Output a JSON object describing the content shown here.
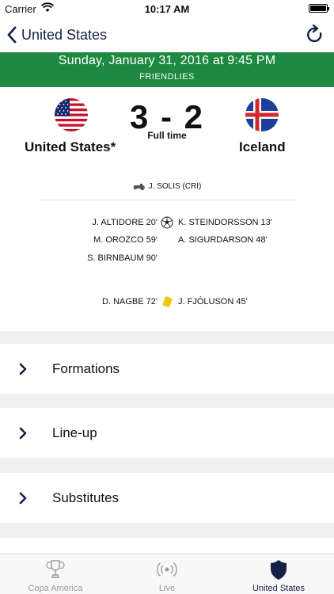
{
  "status_bar": {
    "carrier": "Carrier",
    "time": "10:17 AM"
  },
  "nav": {
    "back_label": "United States"
  },
  "match": {
    "date": "Sunday, January 31, 2016 at 9:45 PM",
    "competition": "FRIENDLIES",
    "home_team": "United States*",
    "away_team": "Iceland",
    "score": "3 - 2",
    "status": "Full time",
    "referee": "J. SOLIS (CRI)"
  },
  "goals": {
    "home": [
      "J. ALTIDORE 20'",
      "M. OROZCO 59'",
      "S. BIRNBAUM 90'"
    ],
    "away": [
      "K. STEINDORSSON 13'",
      "A. SIGURDARSON 48'"
    ]
  },
  "cards": {
    "home": [
      "D. NAGBE 72'"
    ],
    "away": [
      "J. FJÓLUSON 45'"
    ]
  },
  "sections": [
    {
      "label": "Formations"
    },
    {
      "label": "Line-up"
    },
    {
      "label": "Substitutes"
    }
  ],
  "tabbar": [
    {
      "label": "Copa America",
      "icon": "trophy-icon",
      "active": false
    },
    {
      "label": "Live",
      "icon": "live-broadcast-icon",
      "active": false
    },
    {
      "label": "United States",
      "icon": "shield-icon",
      "active": true
    }
  ],
  "colors": {
    "banner_green": "#1e8a41",
    "nav_navy": "#152046",
    "card_yellow": "#f5c400",
    "tab_inactive": "#9a9a9a"
  }
}
